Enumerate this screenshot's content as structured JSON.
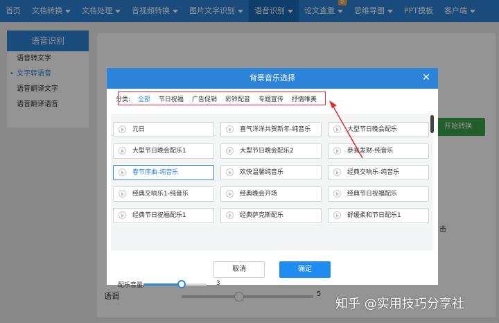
{
  "topnav": {
    "items": [
      {
        "label": "首页",
        "caret": false
      },
      {
        "label": "文档转换",
        "caret": true
      },
      {
        "label": "文档处理",
        "caret": true
      },
      {
        "label": "音视频转换",
        "caret": true
      },
      {
        "label": "图片文字识别",
        "caret": true
      },
      {
        "label": "语音识别",
        "caret": true,
        "active": true
      },
      {
        "label": "论文查重",
        "caret": true,
        "badge": "新"
      },
      {
        "label": "思维导图",
        "caret": true
      },
      {
        "label": "PPT模板",
        "caret": false
      },
      {
        "label": "客户端",
        "caret": true
      }
    ]
  },
  "sidebar": {
    "title": "语音识别",
    "items": [
      {
        "label": "语音转文字"
      },
      {
        "label": "文字转语音",
        "active": true
      },
      {
        "label": "语音翻译文字"
      },
      {
        "label": "语音翻译语音"
      }
    ]
  },
  "page": {
    "green_button": "开始转换",
    "bottom_label": "语调",
    "bottom_value": "5",
    "right_fragment": "击"
  },
  "modal": {
    "title": "背景音乐选择",
    "close_glyph": "✕",
    "category_label": "分类:",
    "categories": [
      {
        "label": "全部",
        "active": true
      },
      {
        "label": "节日祝福"
      },
      {
        "label": "广告促销"
      },
      {
        "label": "彩铃配音"
      },
      {
        "label": "专题宣传"
      },
      {
        "label": "抒情唯美"
      }
    ],
    "tracks": [
      [
        "元日",
        "喜气洋洋共贺新年-纯音乐",
        "大型节日晚会配乐"
      ],
      [
        "大型节日晚会配乐1",
        "大型节日晚会配乐2",
        "恭喜发财-纯音乐"
      ],
      [
        "春节序曲-纯音乐",
        "欢快温馨纯音乐",
        "经典交响乐-纯音乐"
      ],
      [
        "经典交响乐1-纯音乐",
        "经典晚会开场",
        "经典节日祝福配乐"
      ],
      [
        "经典节日祝福配乐1",
        "经典萨克斯配乐",
        "舒缓柔和节日配乐1"
      ]
    ],
    "selected_track": "春节序曲-纯音乐",
    "volume_label": "配乐音量:",
    "volume_value": "3",
    "volume_fraction": 0.6,
    "cancel_label": "取消",
    "ok_label": "确定"
  },
  "watermark": "知乎 @实用技巧分享社",
  "colors": {
    "primary": "#2b84d8",
    "annotation": "#e0292e",
    "green": "#3aa34a"
  }
}
